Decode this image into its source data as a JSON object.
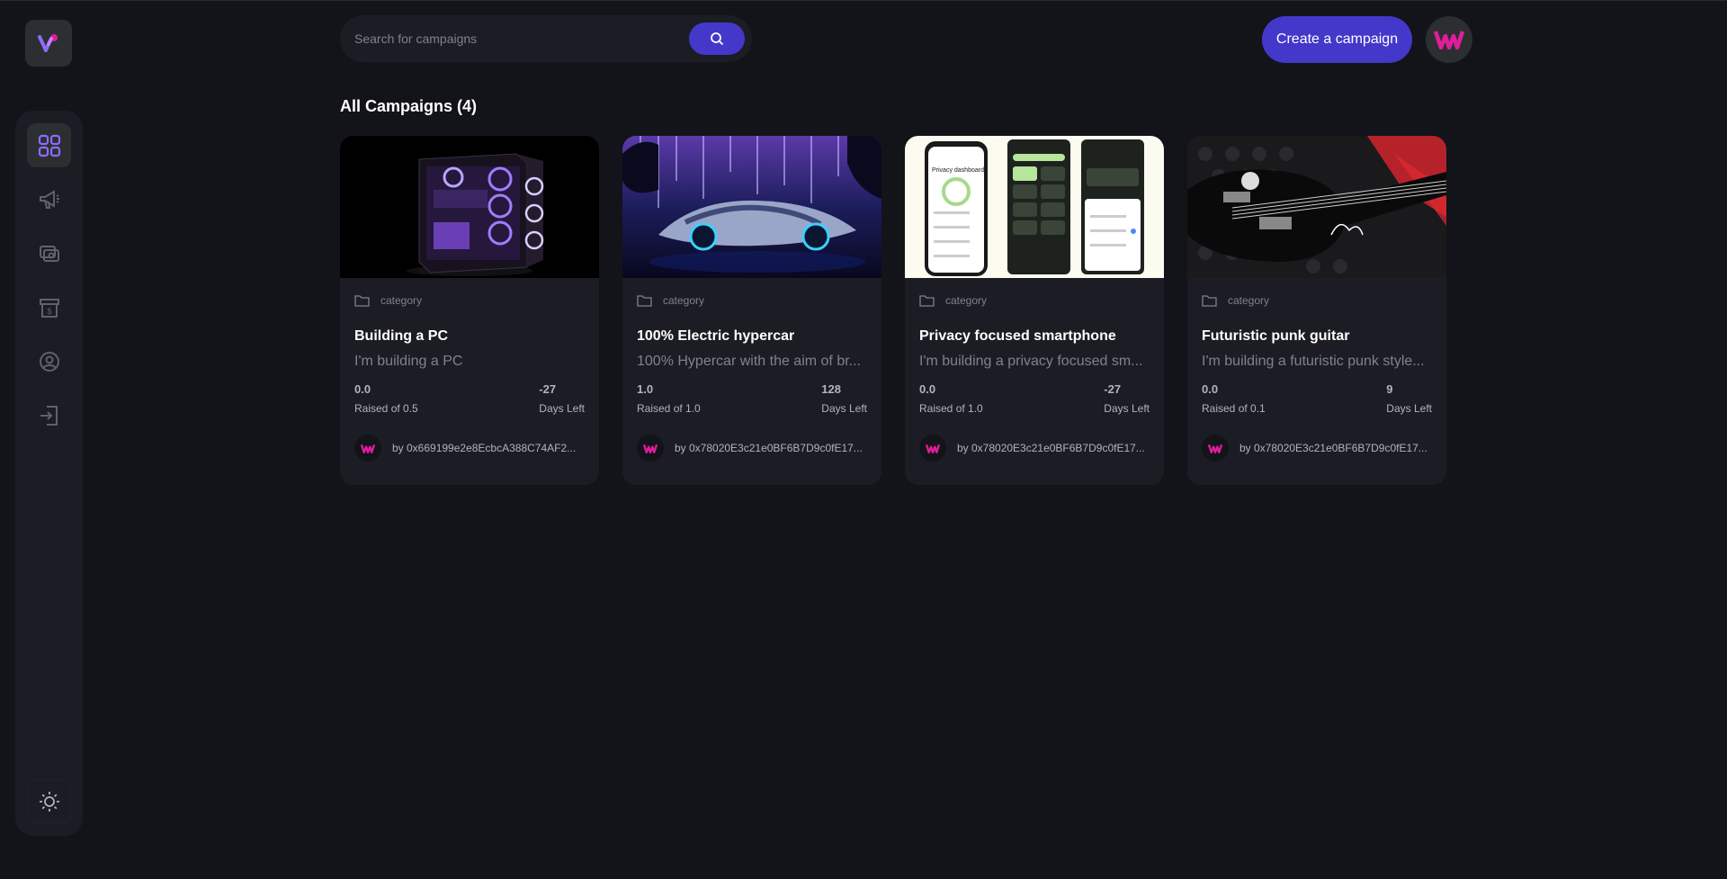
{
  "colors": {
    "background": "#13131a",
    "panel": "#1c1c24",
    "accent": "#4338ca",
    "accent_icon": "#8c6dfd",
    "brand_pink": "#e11d9a",
    "muted_text": "#808191"
  },
  "brand": {
    "logo_icon": "logo-icon"
  },
  "sidebar": {
    "items": [
      {
        "name": "dashboard",
        "icon": "dashboard-icon",
        "active": true
      },
      {
        "name": "campaign",
        "icon": "megaphone-icon",
        "active": false
      },
      {
        "name": "payment",
        "icon": "payment-icon",
        "active": false
      },
      {
        "name": "withdraw",
        "icon": "withdraw-icon",
        "active": false
      },
      {
        "name": "profile",
        "icon": "profile-icon",
        "active": false
      },
      {
        "name": "logout",
        "icon": "logout-icon",
        "active": false
      }
    ],
    "theme_icon": "sun-icon"
  },
  "header": {
    "search_placeholder": "Search for campaigns",
    "search_icon": "search-icon",
    "create_label": "Create a campaign"
  },
  "main": {
    "title": "All Campaigns (4)",
    "campaigns": [
      {
        "category": "category",
        "title": "Building a PC",
        "description": "I'm building a PC",
        "raised": "0.0",
        "raised_label": "Raised of 0.5",
        "days": "-27",
        "days_label": "Days Left",
        "owner": "by 0x669199e2e8EcbcA388C74AF2..."
      },
      {
        "category": "category",
        "title": "100% Electric hypercar",
        "description": "100% Hypercar with the aim of br...",
        "raised": "1.0",
        "raised_label": "Raised of 1.0",
        "days": "128",
        "days_label": "Days Left",
        "owner": "by 0x78020E3c21e0BF6B7D9c0fE17..."
      },
      {
        "category": "category",
        "title": "Privacy focused smartphone",
        "description": "I'm building a privacy focused sm...",
        "raised": "0.0",
        "raised_label": "Raised of 1.0",
        "days": "-27",
        "days_label": "Days Left",
        "owner": "by 0x78020E3c21e0BF6B7D9c0fE17..."
      },
      {
        "category": "category",
        "title": "Futuristic punk guitar",
        "description": "I'm building a futuristic punk style...",
        "raised": "0.0",
        "raised_label": "Raised of 0.1",
        "days": "9",
        "days_label": "Days Left",
        "owner": "by 0x78020E3c21e0BF6B7D9c0fE17..."
      }
    ],
    "phone_screen_text": "Privacy dashboard"
  }
}
